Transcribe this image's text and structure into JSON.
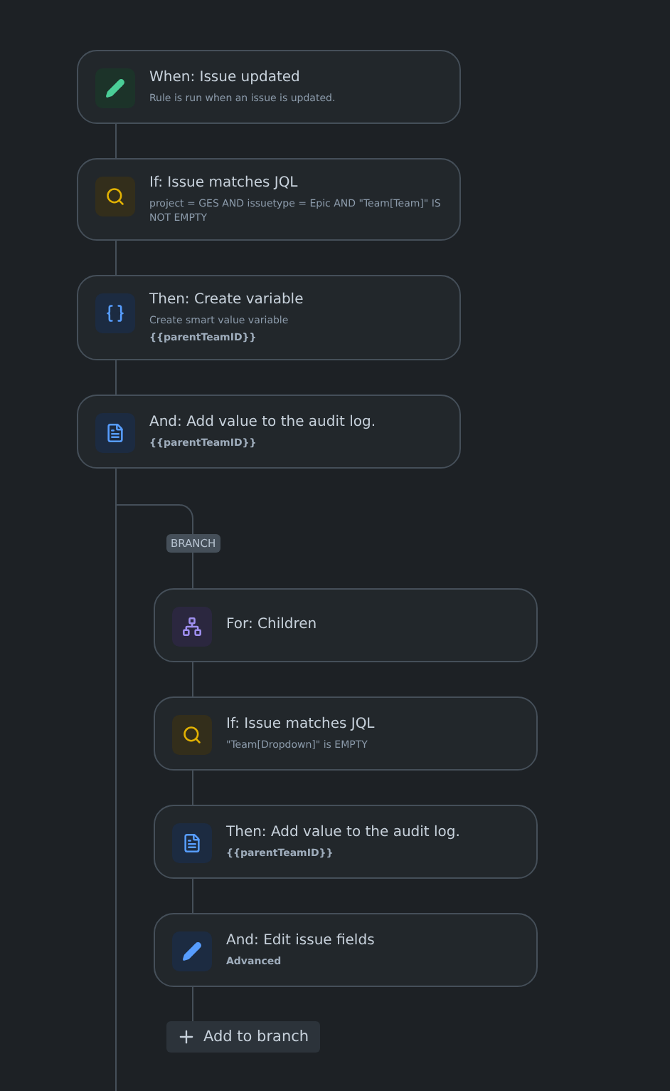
{
  "steps": [
    {
      "kind": "trigger",
      "title": "When: Issue updated",
      "lines": [
        {
          "kind": "plain",
          "text": "Rule is run when an issue is updated."
        }
      ]
    },
    {
      "kind": "condition",
      "title": "If: Issue matches JQL",
      "lines": [
        {
          "kind": "plain",
          "text": "project = GES AND issuetype = Epic AND \"Team[Team]\" IS NOT EMPTY"
        }
      ]
    },
    {
      "kind": "variable",
      "title": "Then: Create variable",
      "lines": [
        {
          "kind": "plain",
          "text": "Create smart value variable"
        },
        {
          "kind": "code",
          "text": "{{parentTeamID}}"
        }
      ]
    },
    {
      "kind": "log",
      "title": "And: Add value to the audit log.",
      "lines": [
        {
          "kind": "code",
          "text": "{{parentTeamID}}"
        }
      ]
    }
  ],
  "branch": {
    "tag": "BRANCH",
    "steps": [
      {
        "kind": "branch",
        "title": "For: Children"
      },
      {
        "kind": "condition",
        "title": "If: Issue matches JQL",
        "lines": [
          {
            "kind": "plain",
            "text": "\"Team[Dropdown]\" is EMPTY"
          }
        ]
      },
      {
        "kind": "log",
        "title": "Then: Add value to the audit log.",
        "lines": [
          {
            "kind": "code",
            "text": "{{parentTeamID}}"
          }
        ]
      },
      {
        "kind": "edit",
        "title": "And: Edit issue fields",
        "lines": [
          {
            "kind": "code",
            "text": "Advanced"
          }
        ]
      }
    ],
    "add_button": "Add to branch"
  }
}
